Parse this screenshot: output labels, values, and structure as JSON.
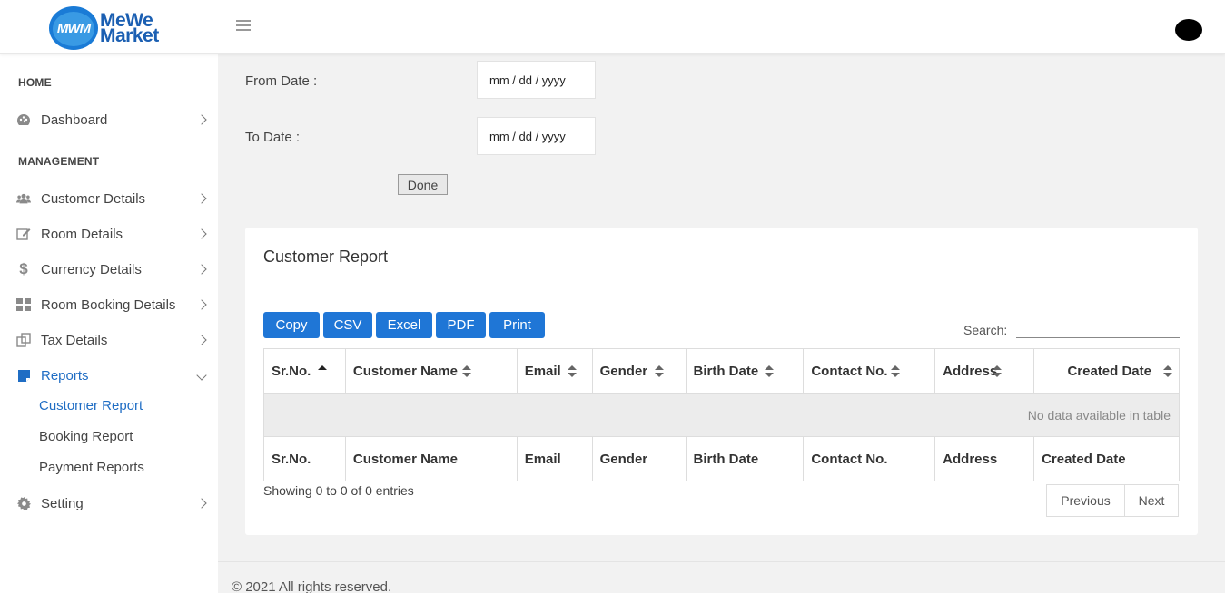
{
  "brand": {
    "logo_mark": "MWM",
    "line1": "MeWe",
    "line2": "Market",
    "color": "#1b5fb2"
  },
  "colors": {
    "accent": "#1f76d6",
    "active_link": "#1f6dc4"
  },
  "sidebar": {
    "home_section": "HOME",
    "management_section": "MANAGEMENT",
    "items": [
      {
        "label": "Dashboard",
        "icon": "palette-icon"
      },
      {
        "label": "Customer Details",
        "icon": "users-icon"
      },
      {
        "label": "Room Details",
        "icon": "edit-icon"
      },
      {
        "label": "Currency Details",
        "icon": "dollar-icon"
      },
      {
        "label": "Room Booking Details",
        "icon": "grid-icon"
      },
      {
        "label": "Tax Details",
        "icon": "copy-icon"
      },
      {
        "label": "Reports",
        "icon": "report-icon",
        "expanded": true
      },
      {
        "label": "Setting",
        "icon": "gear-icon"
      }
    ],
    "report_subitems": [
      "Customer Report",
      "Booking Report",
      "Payment Reports"
    ]
  },
  "filter": {
    "from_label": "From Date :",
    "from_placeholder": "mm / dd / yyyy",
    "to_label": "To Date :",
    "to_placeholder": "mm / dd / yyyy",
    "done_label": "Done"
  },
  "report": {
    "title": "Customer Report",
    "buttons": [
      "Copy",
      "CSV",
      "Excel",
      "PDF",
      "Print"
    ],
    "search_label": "Search:",
    "search_value": "",
    "columns": [
      "Sr.No.",
      "Customer Name",
      "Email",
      "Gender",
      "Birth Date",
      "Contact No.",
      "Address",
      "Created Date"
    ],
    "empty_message": "No data available in table",
    "info": "Showing 0 to 0 of 0 entries",
    "prev_label": "Previous",
    "next_label": "Next"
  },
  "footer": {
    "text": "© 2021 All rights reserved."
  }
}
